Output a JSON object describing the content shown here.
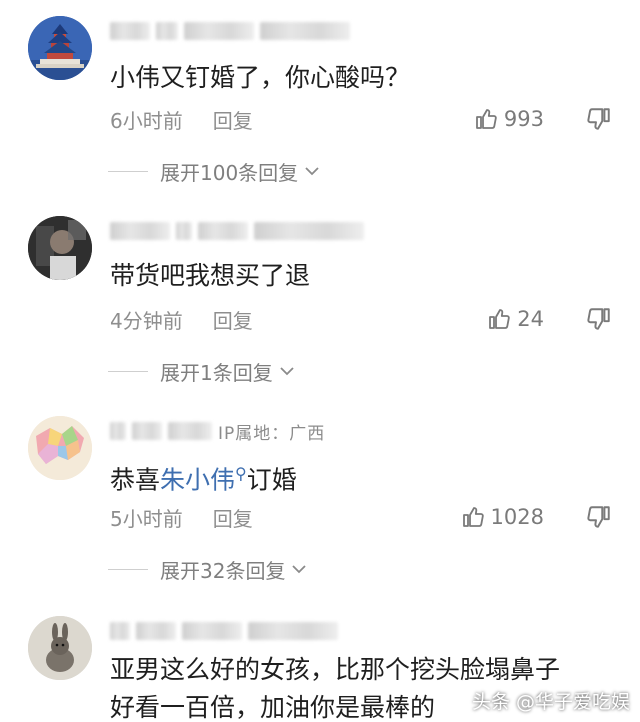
{
  "comments": [
    {
      "body": "小伟又钉婚了，你心酸吗？",
      "time": "6小时前",
      "reply": "回复",
      "likes": "993",
      "expand": "展开100条回复"
    },
    {
      "body": "带货吧我想买了退",
      "time": "4分钟前",
      "reply": "回复",
      "likes": "24",
      "expand": "展开1条回复"
    },
    {
      "name_partial": "IP属地：广西",
      "body_pre": "恭喜",
      "body_link": "朱小伟",
      "body_post": "订婚",
      "time": "5小时前",
      "reply": "回复",
      "likes": "1028",
      "expand": "展开32条回复"
    },
    {
      "body_line1": "亚男这么好的女孩，比那个挖头脸塌鼻子",
      "body_line2": "好看一百倍，加油你是最棒的"
    }
  ],
  "watermark": {
    "source": "头条",
    "author": "@华子爱吃娱"
  },
  "colors": {
    "link": "#3f6fb0",
    "meta_gray": "#8e8e8e",
    "text": "#1f1f1f"
  }
}
